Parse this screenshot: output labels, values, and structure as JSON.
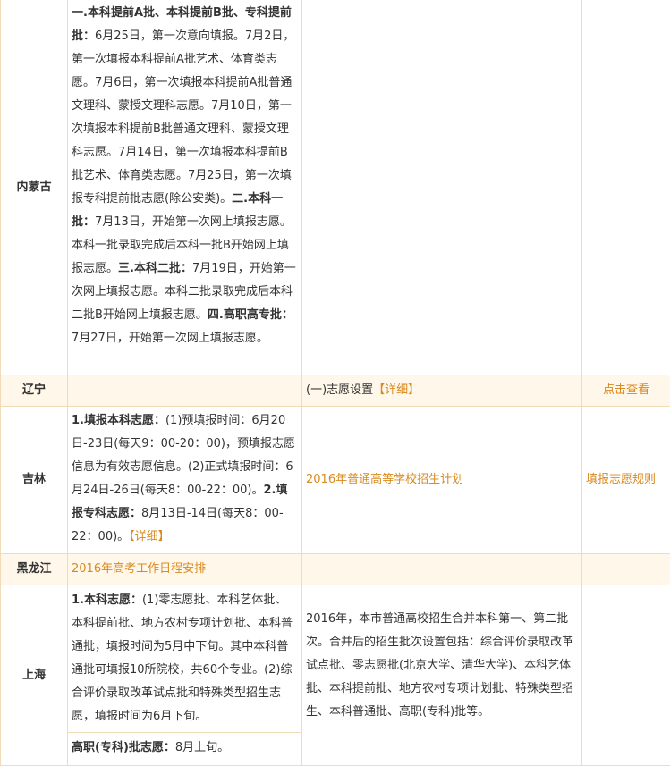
{
  "rows": {
    "neimenggu": {
      "province": "内蒙古",
      "parts": [
        {
          "t": "一.本科提前A批、本科提前B批、专科提前批：",
          "b": true
        },
        {
          "t": "6月25日，第一次意向填报。7月2日，第一次填报本科提前A批艺术、体育类志愿。7月6日，第一次填报本科提前A批普通文理科、蒙授文理科志愿。7月10日，第一次填报本科提前B批普通文理科、蒙授文理科志愿。7月14日，第一次填报本科提前B批艺术、体育类志愿。7月25日，第一次填报专科提前批志愿(除公安类)。"
        },
        {
          "t": "二.本科一批：",
          "b": true
        },
        {
          "t": "7月13日，开始第一次网上填报志愿。本科一批录取完成后本科一批B开始网上填报志愿。"
        },
        {
          "t": "三.本科二批：",
          "b": true
        },
        {
          "t": "7月19日，开始第一次网上填报志愿。本科二批录取完成后本科二批B开始网上填报志愿。"
        },
        {
          "t": "四.高职高专批：",
          "b": true
        },
        {
          "t": "7月27日，开始第一次网上填报志愿。"
        }
      ]
    },
    "liaoning": {
      "province": "辽宁",
      "col3": "(一)志愿设置",
      "col3_link": "【详细】",
      "col4": "点击查看"
    },
    "jilin": {
      "province": "吉林",
      "parts": [
        {
          "t": "1.填报本科志愿：",
          "b": true
        },
        {
          "t": "(1)预填报时间：6月20日-23日(每天9：00-20：00)，预填报志愿信息为有效志愿信息。(2)正式填报时间：6月24日-26日(每天8：00-22：00)。"
        },
        {
          "t": "2.填报专科志愿：",
          "b": true
        },
        {
          "t": "8月13日-14日(每天8：00-22：00)。"
        },
        {
          "t": "【详细】",
          "link": true
        }
      ],
      "col3": "2016年普通高等学校招生计划",
      "col4": "填报志愿规则"
    },
    "heilongjiang": {
      "province": "黑龙江",
      "col2": "2016年高考工作日程安排"
    },
    "shanghai": {
      "province": "上海",
      "parts": [
        {
          "t": "1.本科志愿：",
          "b": true
        },
        {
          "t": "(1)零志愿批、本科艺体批、本科提前批、地方农村专项计划批、本科普通批，填报时间为5月中下旬。其中本科普通批可填报10所院校，共60个专业。(2)综合评价录取改革试点批和特殊类型招生志愿，填报时间为6月下旬。"
        }
      ],
      "sub_parts": [
        {
          "t": "高职(专科)批志愿：",
          "b": true
        },
        {
          "t": "8月上旬。"
        }
      ],
      "col3": "2016年，本市普通高校招生合并本科第一、第二批次。合并后的招生批次设置包括：综合评价录取改革试点批、零志愿批(北京大学、清华大学)、本科艺体批、本科提前批、地方农村专项计划批、特殊类型招生、本科普通批、高职(专科)批等。"
    }
  }
}
